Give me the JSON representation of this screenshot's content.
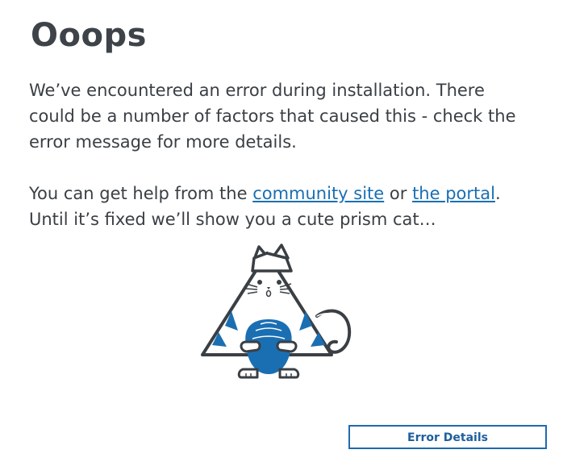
{
  "title": "Ooops",
  "message": {
    "line1": "We’ve encountered an error during installation. There",
    "line2": "could be a number of factors that caused this - check the",
    "line3": "error message for more details."
  },
  "help": {
    "prefix": "You can get help from the ",
    "community_link": "community site",
    "middle": " or ",
    "portal_link": "the portal",
    "suffix": ".",
    "line2": "Until it’s fixed we’ll show you a cute prism cat…"
  },
  "illustration": {
    "icon": "prism-cat-icon",
    "accent_color": "#1a6fb3",
    "outline_color": "#3a3f44"
  },
  "buttons": {
    "error_details": "Error Details"
  },
  "colors": {
    "accent": "#1e6ab0",
    "text": "#3a3f44"
  }
}
